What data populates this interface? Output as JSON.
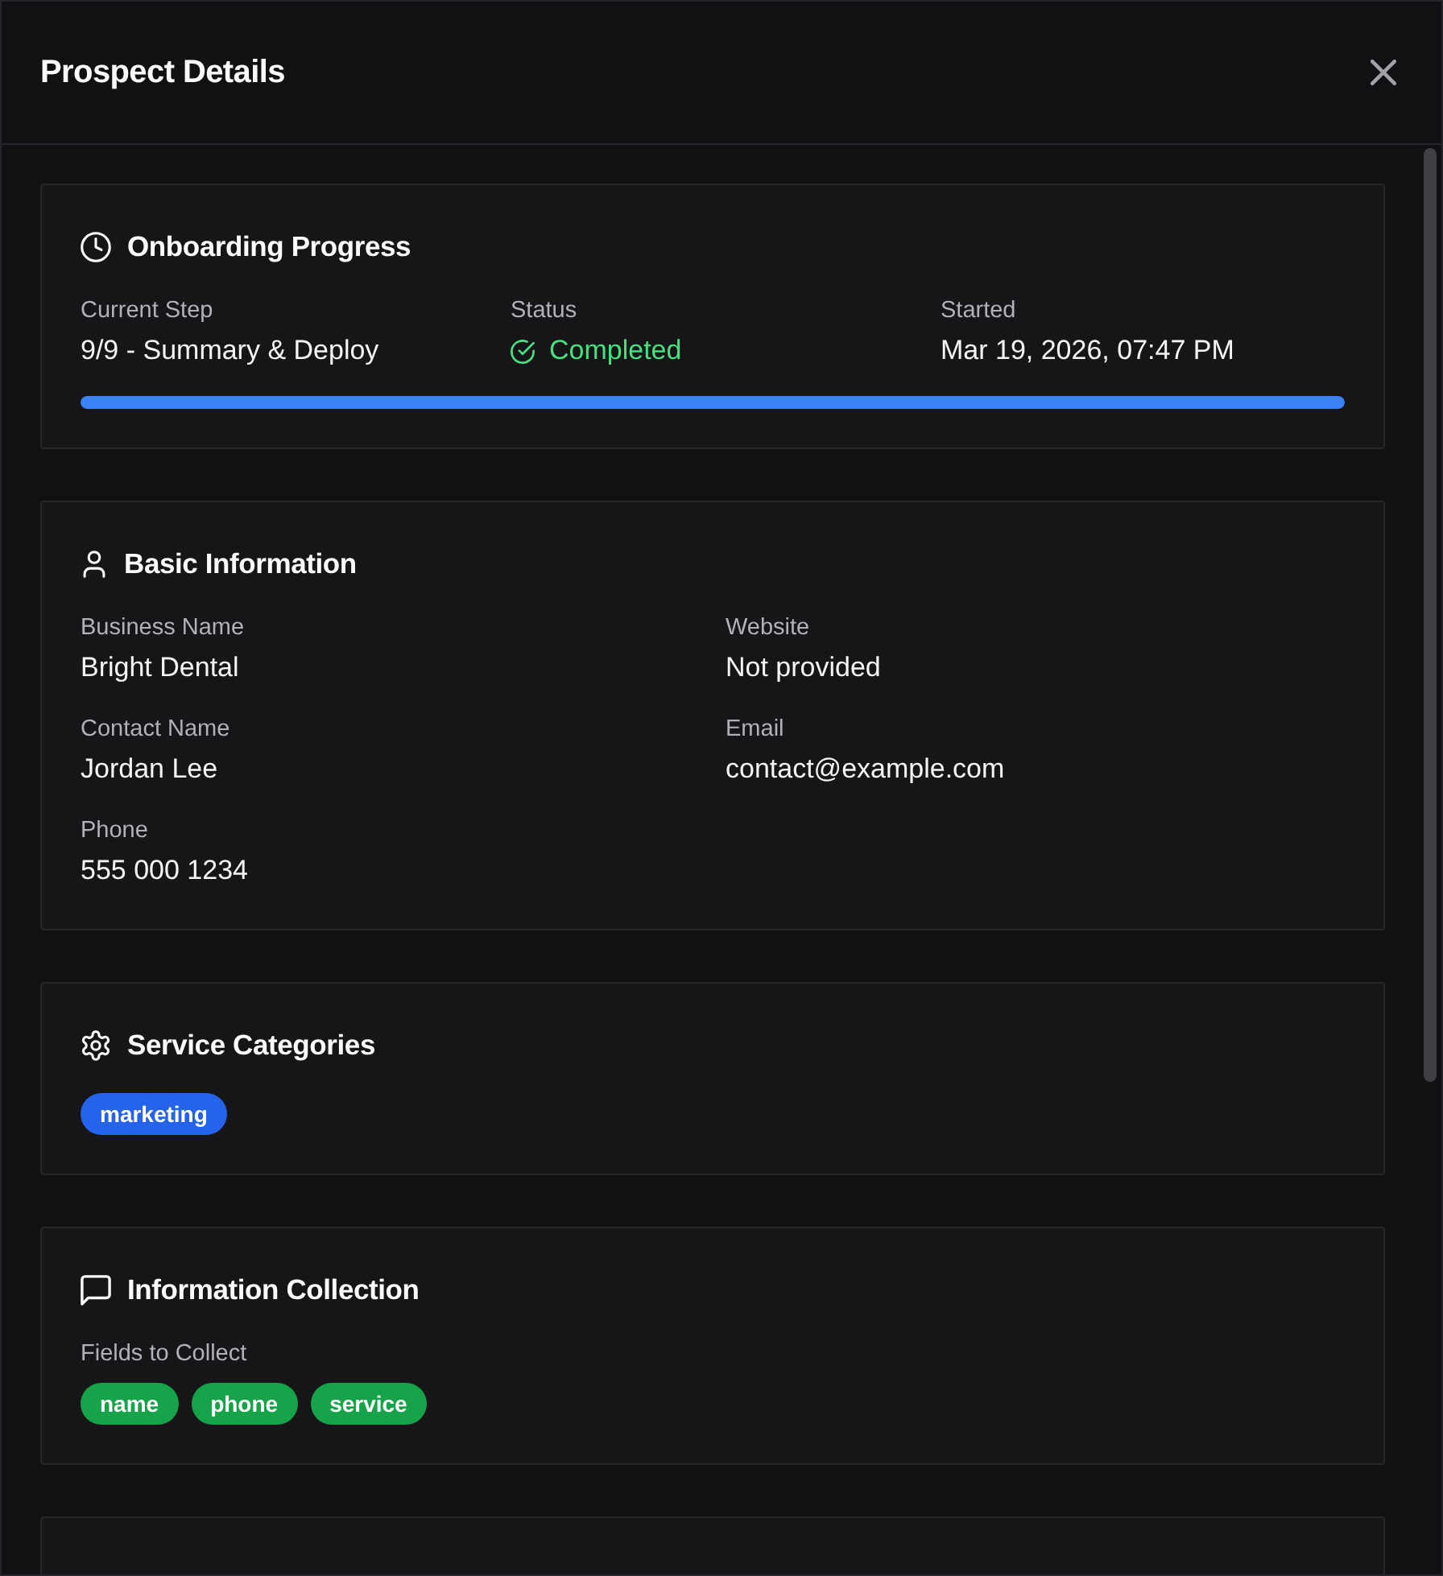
{
  "dialog": {
    "title": "Prospect Details"
  },
  "onboarding_progress": {
    "title": "Onboarding Progress",
    "fields": [
      {
        "label": "Current Step",
        "value": "9/9 - Summary & Deploy",
        "kind": "text"
      },
      {
        "label": "Status",
        "value": "Completed",
        "kind": "status"
      },
      {
        "label": "Started",
        "value": "Mar 19, 2026, 07:47 PM",
        "kind": "text"
      }
    ],
    "level": 1
  },
  "basic_information": {
    "title": "Basic Information",
    "fields": [
      {
        "label": "Business Name",
        "value": "Bright Dental"
      },
      {
        "label": "Website",
        "value": "Not provided"
      },
      {
        "label": "Contact Name",
        "value": "Jordan Lee"
      },
      {
        "label": "Email",
        "value": "contact@example.com"
      },
      {
        "label": "Phone",
        "value": "555 000 1234"
      }
    ]
  },
  "service_categories": {
    "title": "Service Categories",
    "tags": [
      "marketing"
    ]
  },
  "information_collection": {
    "title": "Information Collection",
    "label": "Fields to Collect",
    "tags": [
      "name",
      "phone",
      "service"
    ]
  }
}
